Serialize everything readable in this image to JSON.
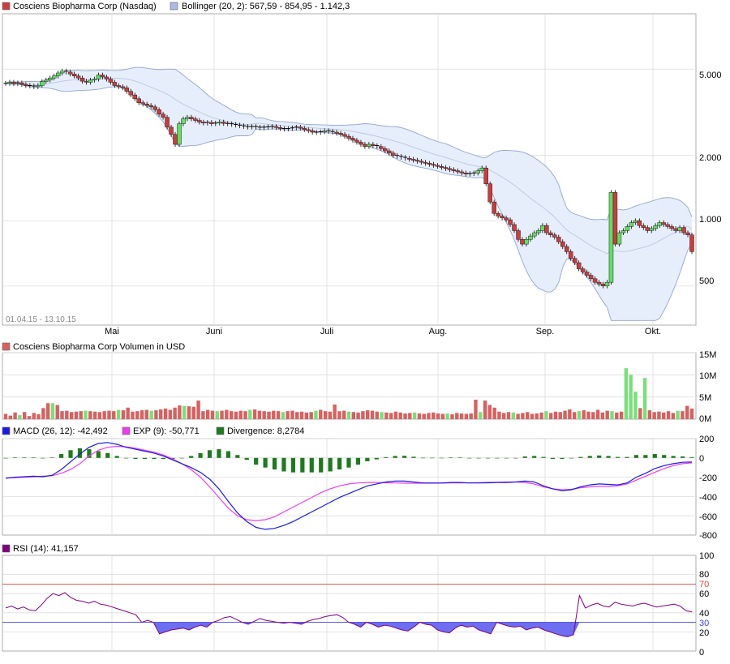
{
  "colors": {
    "up_candle": "#5ee05e",
    "down_candle": "#cc3c3c",
    "band_fill": "#e7eefb",
    "band_line": "#8fa6cf",
    "mid_line": "#b8c7e0",
    "grid": "#dcdcdc",
    "frame": "#9a9a9a",
    "macd": "#1a1ae6",
    "signal": "#f03cf0",
    "divergence": "#1f7a1f",
    "rsi": "#800080",
    "rsi_fill": "#6e6ef0",
    "level70": "#e04040",
    "level30": "#4040e0",
    "vol_up": "#78e078",
    "vol_down": "#d86060"
  },
  "price_panel": {
    "legend": [
      {
        "label": "Cosciens Biopharma Corp (Nasdaq)",
        "swatch": "#cc3c3c"
      },
      {
        "label": "Bollinger (20, 2): 567,59 - 854,95 - 1.142,3",
        "swatch": "#a9bce0"
      }
    ],
    "date_range": "01.04.15 - 13.10.15",
    "y_ticks": [
      "5.000",
      "2.000",
      "1.000",
      "500"
    ],
    "x_ticks": [
      "Mai",
      "Juni",
      "Juli",
      "Aug.",
      "Sep.",
      "Okt."
    ]
  },
  "volume_panel": {
    "legend": "Cosciens Biopharma Corp Volumen in USD",
    "y_ticks": [
      "15M",
      "10M",
      "5M",
      "0M"
    ]
  },
  "macd_panel": {
    "legend": [
      {
        "label": "MACD (26, 12): -42,492",
        "swatch": "#1a1ae6"
      },
      {
        "label": "EXP (9): -50,771",
        "swatch": "#f03cf0"
      },
      {
        "label": "Divergence: 8,2784",
        "swatch": "#1f7a1f"
      }
    ],
    "y_ticks": [
      "200",
      "0",
      "-200",
      "-400",
      "-600",
      "-800"
    ]
  },
  "rsi_panel": {
    "legend": "RSI (14): 41,157",
    "y_ticks": [
      "100",
      "80",
      "60",
      "40",
      "20",
      "0"
    ],
    "level_labels": [
      "70",
      "30"
    ]
  },
  "chart_data": [
    {
      "type": "candlestick",
      "title": "Cosciens Biopharma Corp (Nasdaq)",
      "y_scale": "log",
      "ylim": [
        330,
        9000
      ],
      "x_range": [
        "01.04.15",
        "13.10.15"
      ],
      "close": [
        4300,
        4350,
        4280,
        4320,
        4250,
        4200,
        4180,
        4150,
        4200,
        4380,
        4450,
        4550,
        4650,
        4800,
        4900,
        4850,
        4750,
        4650,
        4550,
        4400,
        4350,
        4450,
        4500,
        4700,
        4600,
        4500,
        4350,
        4200,
        4150,
        4100,
        3950,
        3800,
        3650,
        3500,
        3450,
        3400,
        3350,
        3250,
        3100,
        3000,
        2700,
        2500,
        2250,
        2800,
        2950,
        3000,
        2950,
        2900,
        2850,
        2820,
        2840,
        2800,
        2820,
        2850,
        2810,
        2800,
        2780,
        2760,
        2740,
        2720,
        2700,
        2720,
        2700,
        2680,
        2700,
        2710,
        2720,
        2690,
        2660,
        2650,
        2660,
        2680,
        2700,
        2670,
        2630,
        2600,
        2560,
        2550,
        2570,
        2600,
        2580,
        2560,
        2530,
        2500,
        2450,
        2400,
        2350,
        2300,
        2250,
        2200,
        2250,
        2220,
        2200,
        2150,
        2100,
        2050,
        2000,
        1980,
        1960,
        1940,
        1920,
        1900,
        1880,
        1860,
        1840,
        1820,
        1800,
        1780,
        1760,
        1740,
        1720,
        1700,
        1680,
        1660,
        1640,
        1650,
        1660,
        1700,
        1750,
        1480,
        1220,
        1080,
        1050,
        1030,
        1010,
        960,
        900,
        820,
        780,
        820,
        850,
        880,
        900,
        950,
        880,
        860,
        840,
        800,
        760,
        720,
        670,
        640,
        600,
        580,
        560,
        540,
        520,
        510,
        500,
        520,
        1350,
        780,
        880,
        900,
        940,
        980,
        1000,
        950,
        930,
        900,
        920,
        950,
        980,
        960,
        940,
        920,
        900,
        930,
        880,
        860,
        720
      ],
      "bollinger": {
        "period": 20,
        "k": 2,
        "lower": 567.59,
        "middle": 854.95,
        "upper": 1142.3
      }
    },
    {
      "type": "bar",
      "title": "Cosciens Biopharma Corp Volumen in USD",
      "ylim": [
        0,
        15
      ],
      "unit": "M",
      "values": [
        1.2,
        0.8,
        1.5,
        0.9,
        1.6,
        0.7,
        1.4,
        1.1,
        2.5,
        3.6,
        3.6,
        3.2,
        1.8,
        1.9,
        1.6,
        1.7,
        1.8,
        1.9,
        1.8,
        1.7,
        1.6,
        1.8,
        1.9,
        1.8,
        2.1,
        2.0,
        2.6,
        1.7,
        1.8,
        2.0,
        2.1,
        1.9,
        2.0,
        2.2,
        2.4,
        2.1,
        2.6,
        3.1,
        3.0,
        2.9,
        2.8,
        4.2,
        1.8,
        2.1,
        1.9,
        1.8,
        1.9,
        2.1,
        1.8,
        1.7,
        1.9,
        1.8,
        2.1,
        2.2,
        1.9,
        1.8,
        1.7,
        1.9,
        1.8,
        1.6,
        1.8,
        1.9,
        1.6,
        1.7,
        1.5,
        1.6,
        1.9,
        2.1,
        1.8,
        1.7,
        3.3,
        1.8,
        1.9,
        1.7,
        1.6,
        1.5,
        1.8,
        2.0,
        1.9,
        1.7,
        1.6,
        1.5,
        1.4,
        1.7,
        1.5,
        1.3,
        1.4,
        1.5,
        1.3,
        1.2,
        1.4,
        1.5,
        1.3,
        1.2,
        1.3,
        1.1,
        1.4,
        1.3,
        1.2,
        1.3,
        4.4,
        1.6,
        4.2,
        3.2,
        2.6,
        1.7,
        1.4,
        1.6,
        1.5,
        1.2,
        1.4,
        1.6,
        1.2,
        1.3,
        1.5,
        1.8,
        1.4,
        1.7,
        1.6,
        1.9,
        2.2,
        1.6,
        1.8,
        2.0,
        1.7,
        1.6,
        2.1,
        1.5,
        1.9,
        1.8,
        1.5,
        1.7,
        11.5,
        10.0,
        6.2,
        2.5,
        9.3,
        2.0,
        1.6,
        1.7,
        1.5,
        1.8,
        1.4,
        1.9,
        1.8,
        3.0,
        2.4
      ]
    },
    {
      "type": "line",
      "title": "MACD (26, 12)",
      "ylim": [
        -800,
        200
      ],
      "macd": [
        -210,
        -200,
        -195,
        -190,
        -195,
        -180,
        -120,
        -40,
        40,
        110,
        150,
        160,
        140,
        110,
        90,
        70,
        50,
        20,
        -20,
        -60,
        -100,
        -150,
        -220,
        -320,
        -450,
        -570,
        -660,
        -720,
        -740,
        -730,
        -700,
        -660,
        -610,
        -560,
        -510,
        -460,
        -410,
        -370,
        -330,
        -290,
        -270,
        -250,
        -240,
        -240,
        -250,
        -260,
        -260,
        -260,
        -255,
        -255,
        -260,
        -260,
        -258,
        -255,
        -255,
        -250,
        -240,
        -250,
        -290,
        -320,
        -340,
        -330,
        -300,
        -280,
        -270,
        -275,
        -280,
        -260,
        -200,
        -160,
        -110,
        -80,
        -60,
        -45,
        -42
      ],
      "signal": [
        -210,
        -205,
        -200,
        -195,
        -190,
        -185,
        -160,
        -120,
        -60,
        20,
        80,
        110,
        120,
        115,
        100,
        80,
        60,
        30,
        -10,
        -60,
        -120,
        -200,
        -300,
        -410,
        -520,
        -600,
        -640,
        -650,
        -640,
        -610,
        -560,
        -510,
        -460,
        -410,
        -360,
        -320,
        -290,
        -270,
        -260,
        -255,
        -255,
        -258,
        -260,
        -262,
        -262,
        -262,
        -262,
        -261,
        -260,
        -260,
        -258,
        -256,
        -254,
        -252,
        -250,
        -250,
        -255,
        -270,
        -300,
        -320,
        -330,
        -325,
        -310,
        -300,
        -295,
        -295,
        -290,
        -270,
        -230,
        -190,
        -150,
        -110,
        -80,
        -60,
        -51
      ],
      "divergence": [
        0,
        5,
        5,
        5,
        -5,
        5,
        40,
        80,
        100,
        90,
        70,
        50,
        20,
        -5,
        -10,
        -10,
        -10,
        -10,
        -10,
        0,
        20,
        50,
        80,
        90,
        70,
        30,
        -20,
        -70,
        -100,
        -120,
        -140,
        -150,
        -150,
        -150,
        -150,
        -140,
        -120,
        -100,
        -70,
        -35,
        -15,
        8,
        20,
        22,
        12,
        2,
        2,
        1,
        5,
        5,
        -2,
        -4,
        -4,
        -3,
        -5,
        0,
        15,
        20,
        10,
        -10,
        -10,
        -5,
        10,
        20,
        25,
        20,
        10,
        10,
        30,
        30,
        40,
        30,
        20,
        15,
        8.2784
      ]
    },
    {
      "type": "line",
      "title": "RSI (14)",
      "ylim": [
        0,
        100
      ],
      "levels": [
        70,
        30
      ],
      "values": [
        45,
        47,
        44,
        46,
        43,
        42,
        48,
        55,
        60,
        58,
        61,
        56,
        53,
        52,
        50,
        52,
        49,
        48,
        46,
        44,
        42,
        40,
        38,
        30,
        32,
        30,
        18,
        20,
        22,
        23,
        24,
        22,
        25,
        27,
        25,
        30,
        32,
        35,
        36,
        33,
        30,
        28,
        31,
        34,
        32,
        31,
        30,
        29,
        30,
        29,
        28,
        31,
        33,
        34,
        36,
        37,
        38,
        35,
        30,
        28,
        25,
        30,
        28,
        25,
        27,
        26,
        24,
        22,
        21,
        25,
        30,
        28,
        27,
        22,
        20,
        19,
        24,
        27,
        25,
        26,
        22,
        20,
        18,
        30,
        28,
        26,
        25,
        26,
        22,
        24,
        25,
        22,
        20,
        18,
        16,
        15,
        17,
        58,
        45,
        48,
        50,
        47,
        46,
        51,
        49,
        48,
        47,
        49,
        50,
        48,
        46,
        47,
        48,
        49,
        47,
        42,
        41
      ]
    }
  ]
}
